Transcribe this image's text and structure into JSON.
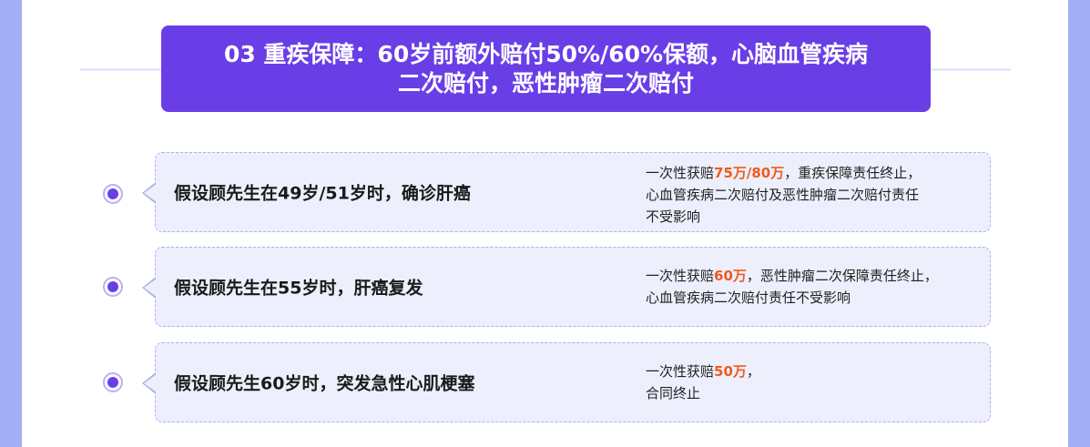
{
  "header": {
    "title_line1": "03 重疾保障：60岁前额外赔付50%/60%保额，心脑血管疾病",
    "title_line2": "二次赔付，恶性肿瘤二次赔付"
  },
  "items": [
    {
      "case": "假设顾先生在49岁/51岁时，确诊肝癌",
      "desc_prefix": "一次性获赔",
      "desc_amount": "75万/80万",
      "desc_suffix": "，重疾保障责任终止，",
      "desc_line2": "心血管疾病二次赔付及恶性肿瘤二次赔付责任",
      "desc_line3": "不受影响"
    },
    {
      "case": "假设顾先生在55岁时，肝癌复发",
      "desc_prefix": "一次性获赔",
      "desc_amount": "60万",
      "desc_suffix": "，恶性肿瘤二次保障责任终止，",
      "desc_line2": "心血管疾病二次赔付责任不受影响",
      "desc_line3": ""
    },
    {
      "case": "假设顾先生60岁时，突发急性心肌梗塞",
      "desc_prefix": "一次性获赔",
      "desc_amount": "50万",
      "desc_suffix": "，",
      "desc_line2": "合同终止",
      "desc_line3": ""
    }
  ],
  "colors": {
    "accent": "#6a3ee6",
    "highlight": "#f05a1e",
    "card_bg": "#edeffc",
    "side_bar": "#a3aef5"
  }
}
